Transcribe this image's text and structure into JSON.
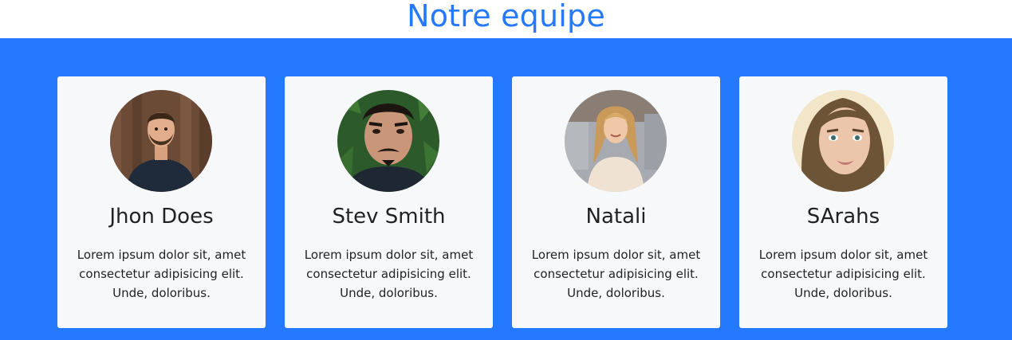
{
  "header": {
    "title": "Notre equipe"
  },
  "colors": {
    "accent": "#2479ff",
    "card_bg": "#f7f8fa",
    "text": "#222222"
  },
  "team": [
    {
      "name": "Jhon Does",
      "bio": "Lorem ipsum dolor sit, amet consectetur adipisicing elit. Unde, doloribus.",
      "avatar_icon": "man-beard-wood-wall-photo"
    },
    {
      "name": "Stev Smith",
      "bio": "Lorem ipsum dolor sit, amet consectetur adipisicing elit. Unde, doloribus.",
      "avatar_icon": "man-mustache-leaves-photo"
    },
    {
      "name": "Natali",
      "bio": "Lorem ipsum dolor sit, amet consectetur adipisicing elit. Unde, doloribus.",
      "avatar_icon": "woman-blonde-street-photo"
    },
    {
      "name": "SArahs",
      "bio": "Lorem ipsum dolor sit, amet consectetur adipisicing elit. Unde, doloribus.",
      "avatar_icon": "woman-brunette-selfie-photo"
    }
  ]
}
